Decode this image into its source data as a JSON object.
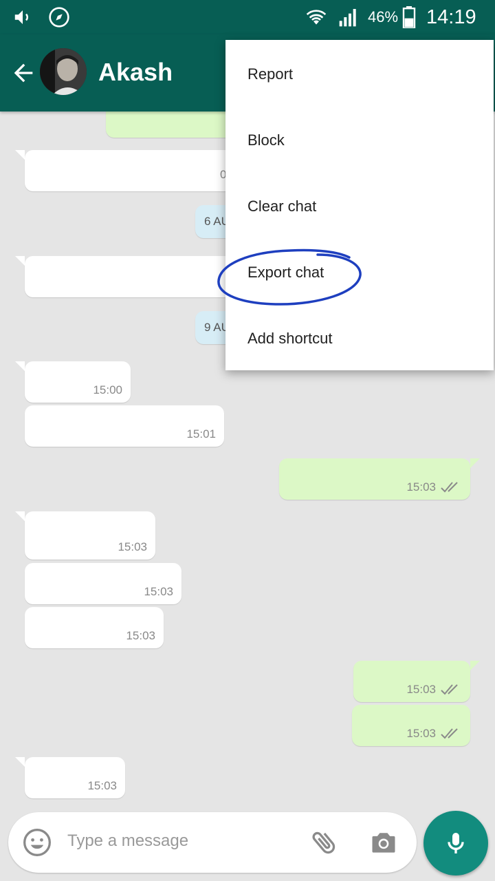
{
  "status_bar": {
    "battery": "46%",
    "time": "14:19"
  },
  "header": {
    "contact_name": "Akash"
  },
  "menu": {
    "items": [
      {
        "label": "Report"
      },
      {
        "label": "Block"
      },
      {
        "label": "Clear chat"
      },
      {
        "label": "Export chat"
      },
      {
        "label": "Add shortcut"
      }
    ]
  },
  "chat": {
    "date_chips": [
      "6 AU",
      "9 AU"
    ],
    "partial_time": "0",
    "messages": [
      {
        "direction": "in",
        "time": "15:00"
      },
      {
        "direction": "in",
        "time": "15:01"
      },
      {
        "direction": "out",
        "time": "15:03",
        "status": "double-check-icon"
      },
      {
        "direction": "in",
        "time": "15:03"
      },
      {
        "direction": "in",
        "time": "15:03"
      },
      {
        "direction": "in",
        "time": "15:03"
      },
      {
        "direction": "out",
        "time": "15:03",
        "status": "double-check-icon"
      },
      {
        "direction": "out",
        "time": "15:03",
        "status": "double-check-icon"
      },
      {
        "direction": "in",
        "time": "15:03"
      }
    ]
  },
  "composer": {
    "placeholder": "Type a message"
  },
  "colors": {
    "primary": "#075e54",
    "accent": "#128c7e",
    "outgoing_bubble": "#dcf8c6",
    "annotation": "#1e3fbf"
  }
}
